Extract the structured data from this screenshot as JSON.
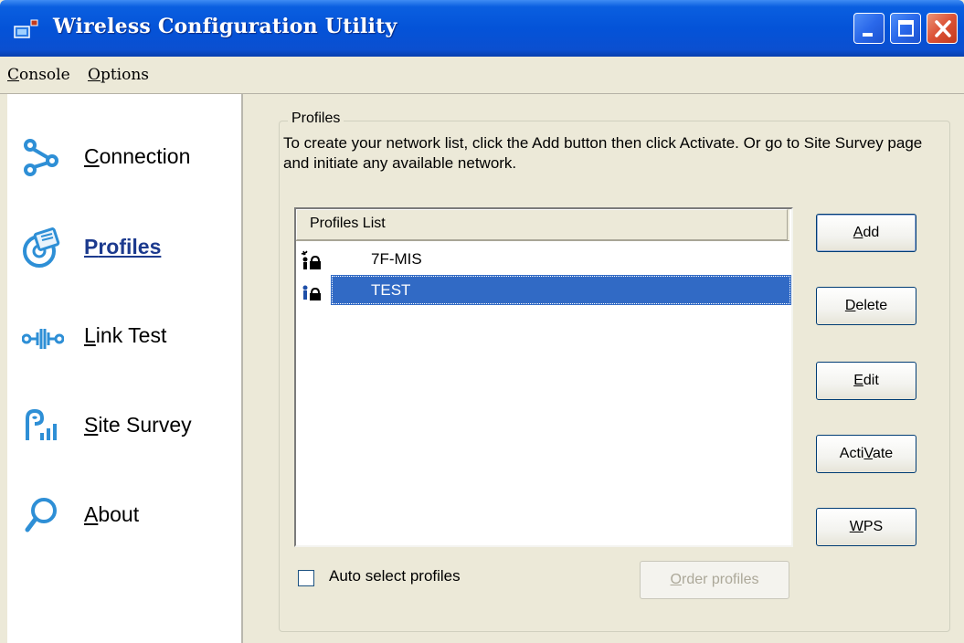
{
  "window": {
    "title": "Wireless Configuration Utility"
  },
  "menu": {
    "console_pre": "",
    "console_ul": "C",
    "console_post": "onsole",
    "options_pre": "",
    "options_ul": "O",
    "options_post": "ptions"
  },
  "sidebar": {
    "items": [
      {
        "icon": "connection-icon",
        "pre": "",
        "ul": "C",
        "post": "onnection",
        "active": false
      },
      {
        "icon": "profiles-icon",
        "pre": "",
        "ul": "P",
        "post": "rofiles",
        "active": true
      },
      {
        "icon": "link-test-icon",
        "pre": "",
        "ul": "L",
        "post": "ink Test",
        "active": false
      },
      {
        "icon": "site-survey-icon",
        "pre": "",
        "ul": "S",
        "post": "ite Survey",
        "active": false
      },
      {
        "icon": "about-icon",
        "pre": "",
        "ul": "A",
        "post": "bout",
        "active": false
      }
    ]
  },
  "profiles": {
    "group_title": "Profiles",
    "instructions": "To create your network list, click the Add button then click Activate. Or go to Site Survey page and initiate any available network.",
    "list_header": "Profiles List",
    "rows": [
      {
        "name": "7F-MIS",
        "icon": "connected-profile-icon",
        "selected": false
      },
      {
        "name": "TEST",
        "icon": "profile-icon",
        "selected": true
      }
    ],
    "auto_select_label": "Auto select profiles",
    "auto_select_checked": false
  },
  "buttons": {
    "add": {
      "pre": "",
      "ul": "A",
      "post": "dd"
    },
    "delete": {
      "pre": "",
      "ul": "D",
      "post": "elete"
    },
    "edit": {
      "pre": "",
      "ul": "E",
      "post": "dit"
    },
    "activate": {
      "pre": "Acti",
      "ul": "V",
      "post": "ate"
    },
    "wps": {
      "pre": "",
      "ul": "W",
      "post": "PS"
    },
    "order": {
      "pre": "",
      "ul": "O",
      "post": "rder profiles",
      "disabled": true
    }
  },
  "colors": {
    "titlebar": "#0453d8",
    "selection": "#316ac5",
    "active_nav": "#1c3a8e",
    "icon_blue": "#2e8fd6"
  }
}
